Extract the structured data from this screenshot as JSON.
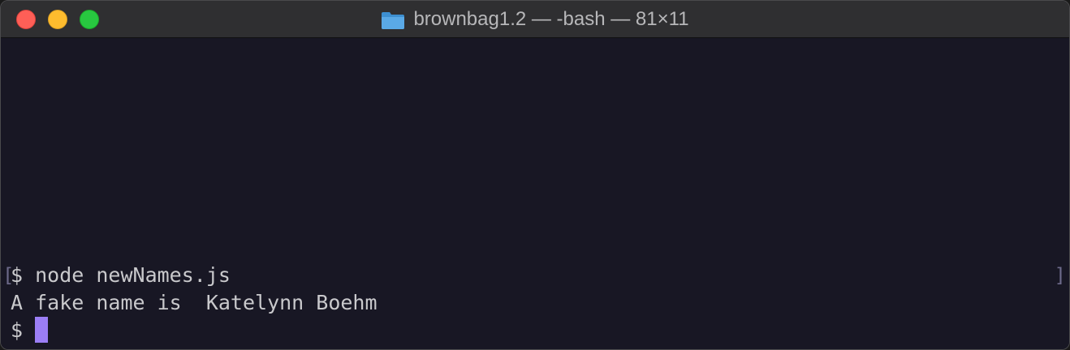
{
  "window": {
    "title": "brownbag1.2 — -bash — 81×11"
  },
  "terminal": {
    "lines": [
      {
        "prompt": "$",
        "text": " node newNames.js"
      },
      {
        "prompt": "",
        "text": "A fake name is  Katelynn Boehm"
      },
      {
        "prompt": "$",
        "text": " "
      }
    ],
    "mark_left": "[",
    "mark_right": "]"
  },
  "colors": {
    "background": "#181724",
    "titlebar": "#2f2f31",
    "text": "#c9c9cc",
    "cursor": "#9b7ef5",
    "close": "#fe5f57",
    "minimize": "#febc2e",
    "maximize": "#28c840",
    "folder": "#5aa9e6"
  }
}
